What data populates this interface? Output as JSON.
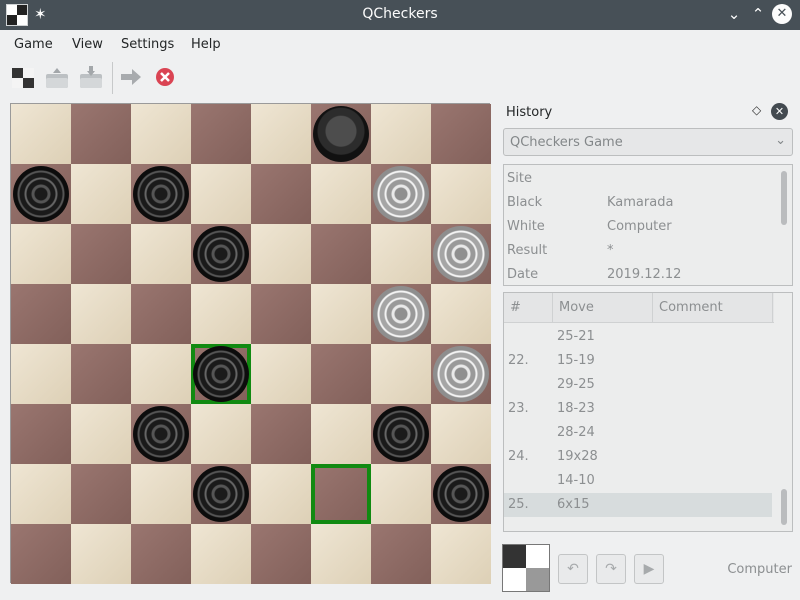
{
  "window": {
    "title": "QCheckers"
  },
  "menu": [
    "Game",
    "View",
    "Settings",
    "Help"
  ],
  "toolbar": {
    "new_icon": "new-game-icon",
    "open_icon": "open-icon",
    "save_icon": "save-icon",
    "next_icon": "next-round-icon",
    "stop_icon": "stop-icon"
  },
  "board": {
    "rows": [
      [
        "",
        "",
        "",
        "",
        "",
        "bk",
        "",
        ""
      ],
      [
        "b",
        "",
        "b",
        "",
        "",
        "",
        "w",
        ""
      ],
      [
        "",
        "",
        "",
        "b",
        "",
        "",
        "",
        "w"
      ],
      [
        "",
        "",
        "",
        "",
        "",
        "",
        "w",
        ""
      ],
      [
        "",
        "",
        "",
        "b",
        "",
        "",
        "",
        "w"
      ],
      [
        "",
        "",
        "b",
        "",
        "",
        "",
        "b",
        ""
      ],
      [
        "",
        "",
        "",
        "b",
        "",
        "",
        "",
        "b"
      ],
      [
        "",
        "",
        "",
        "",
        "",
        "",
        "",
        ""
      ]
    ],
    "highlighted": [
      [
        4,
        3
      ],
      [
        6,
        5
      ]
    ],
    "highlight_color": "#118a11"
  },
  "history_panel": {
    "title": "History",
    "game_select": "QCheckers Game",
    "info": [
      {
        "key": "Site",
        "value": ""
      },
      {
        "key": "Black",
        "value": "Kamarada"
      },
      {
        "key": "White",
        "value": "Computer"
      },
      {
        "key": "Result",
        "value": "*"
      },
      {
        "key": "Date",
        "value": "2019.12.12"
      }
    ],
    "columns": [
      "#",
      "Move",
      "Comment"
    ],
    "moves": [
      {
        "num": "",
        "move": "25-21",
        "comment": ""
      },
      {
        "num": "22.",
        "move": "15-19",
        "comment": ""
      },
      {
        "num": "",
        "move": "29-25",
        "comment": ""
      },
      {
        "num": "23.",
        "move": "18-23",
        "comment": ""
      },
      {
        "num": "",
        "move": "28-24",
        "comment": ""
      },
      {
        "num": "24.",
        "move": "19x28",
        "comment": ""
      },
      {
        "num": "",
        "move": "14-10",
        "comment": ""
      },
      {
        "num": "25.",
        "move": "6x15",
        "comment": ""
      }
    ],
    "selected_index": 7
  },
  "status": {
    "player": "Computer"
  }
}
